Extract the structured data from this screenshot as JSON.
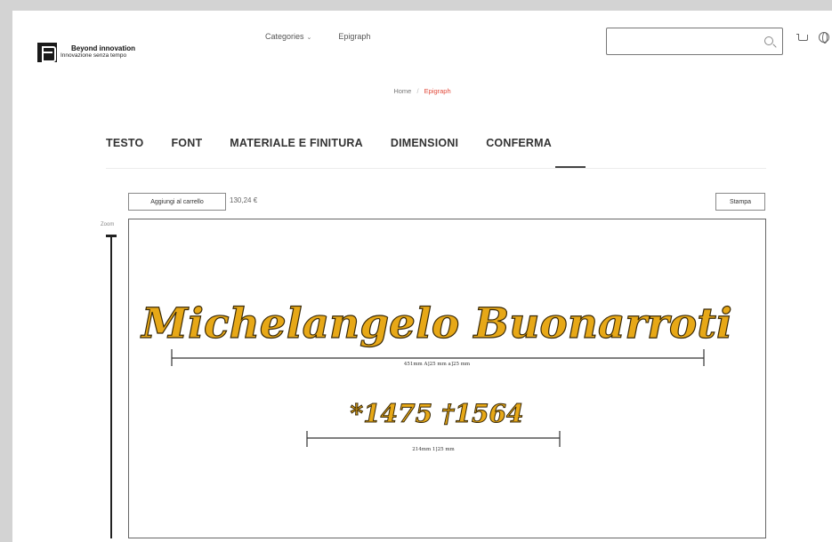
{
  "brand": {
    "title": "Beyond innovation",
    "subtitle": "Innovazione senza tempo"
  },
  "nav": {
    "categories": "Categories",
    "epigraph": "Epigraph"
  },
  "search": {
    "placeholder": "",
    "value": ""
  },
  "breadcrumb": {
    "home": "Home",
    "separator": "/",
    "current": "Epigraph"
  },
  "tabs": [
    "TESTO",
    "FONT",
    "MATERIALE E FINITURA",
    "DIMENSIONI",
    "CONFERMA"
  ],
  "active_tab": "CONFERMA",
  "actions": {
    "add_to_cart": "Aggiungi al carrello",
    "price": "130,24 €",
    "print": "Stampa"
  },
  "zoom": {
    "label": "Zoom"
  },
  "epigraph": {
    "name": "Michelangelo Buonarroti",
    "name_dimension": "451mm A]25 mm a]25 mm",
    "dates": "*1475 †1564",
    "dates_dimension": "214mm 1]25 mm"
  },
  "colors": {
    "accent": "#e24a3b",
    "letter_fill": "#e7a817",
    "letter_stroke": "#3a2a08"
  }
}
